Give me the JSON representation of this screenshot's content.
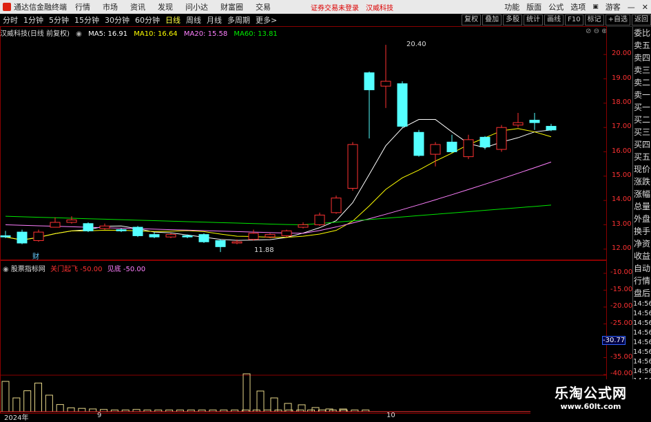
{
  "titlebar": {
    "app_name": "通达信金融终端",
    "menus": [
      "行情",
      "市场",
      "资讯",
      "发现",
      "问小达",
      "财富圈",
      "交易"
    ],
    "notice": "证券交易未登录",
    "stock_name_top": "汉威科技",
    "right_items": [
      "功能",
      "版面",
      "公式",
      "选项"
    ],
    "user": "游客"
  },
  "toolbar": {
    "periods": [
      "分时",
      "1分钟",
      "5分钟",
      "15分钟",
      "30分钟",
      "60分钟",
      "日线",
      "周线",
      "月线",
      "多周期",
      "更多>"
    ],
    "active_period": "日线",
    "right_buttons": [
      "复权",
      "叠加",
      "多股",
      "统计",
      "画线",
      "F10",
      "标记",
      "+自选",
      "返回"
    ]
  },
  "infobar": {
    "title": "汉威科技(日线 前复权)",
    "ma5": "MA5: 16.91",
    "ma10": "MA10: 16.64",
    "ma20": "MA20: 15.58",
    "ma60": "MA60: 13.81"
  },
  "price_axis": [
    "20.00",
    "19.00",
    "18.00",
    "17.00",
    "16.00",
    "15.00",
    "14.00",
    "13.00",
    "12.00"
  ],
  "annotations": {
    "high": "20.40",
    "low": "11.88",
    "cai": "财"
  },
  "indicator": {
    "name": "股票指标网",
    "l1": "关门起飞",
    "v1": "-50.00",
    "l2": "见底",
    "v2": "-50.00",
    "axis": [
      "-10.00",
      "-15.00",
      "-20.00",
      "-25.00",
      "-30.77",
      "-35.00",
      "-40.00"
    ],
    "current": "-30.77"
  },
  "date_axis": {
    "year": "2024年",
    "m1": "9",
    "m2": "10"
  },
  "right_panel": [
    "委比",
    "卖五",
    "卖四",
    "卖三",
    "卖二",
    "卖一",
    "买一",
    "买二",
    "买三",
    "买四",
    "买五",
    "现价",
    "涨跌",
    "涨幅",
    "总量",
    "外盘",
    "换手",
    "净资",
    "收益",
    "自动",
    "行情",
    "盘后",
    "14:56",
    "14:56",
    "14:56",
    "14:56",
    "14:56",
    "14:56",
    "14:56",
    "14:56",
    "14:56"
  ],
  "watermark": {
    "line1": "乐淘公式网",
    "line2": "www.60lt.com"
  },
  "colors": {
    "up": "#ff3232",
    "down": "#54ffff",
    "ma5": "#ffffff",
    "ma10": "#ffff00",
    "ma20": "#ff80ff",
    "ma60": "#00e600"
  },
  "candles": [
    {
      "o": 12.55,
      "c": 12.5,
      "h": 12.75,
      "l": 12.45
    },
    {
      "o": 12.7,
      "c": 12.25,
      "h": 12.8,
      "l": 12.2
    },
    {
      "o": 12.35,
      "c": 12.7,
      "h": 12.8,
      "l": 12.3
    },
    {
      "o": 12.9,
      "c": 13.1,
      "h": 13.3,
      "l": 12.9
    },
    {
      "o": 13.1,
      "c": 13.2,
      "h": 13.35,
      "l": 13.05
    },
    {
      "o": 13.05,
      "c": 12.75,
      "h": 13.1,
      "l": 12.7
    },
    {
      "o": 12.85,
      "c": 12.95,
      "h": 13.05,
      "l": 12.8
    },
    {
      "o": 12.8,
      "c": 12.75,
      "h": 12.85,
      "l": 12.7
    },
    {
      "o": 12.9,
      "c": 12.55,
      "h": 12.95,
      "l": 12.5
    },
    {
      "o": 12.6,
      "c": 12.5,
      "h": 12.7,
      "l": 12.45
    },
    {
      "o": 12.5,
      "c": 12.6,
      "h": 12.65,
      "l": 12.45
    },
    {
      "o": 12.55,
      "c": 12.5,
      "h": 12.6,
      "l": 12.45
    },
    {
      "o": 12.6,
      "c": 12.3,
      "h": 12.65,
      "l": 12.25
    },
    {
      "o": 12.35,
      "c": 12.1,
      "h": 12.4,
      "l": 11.88
    },
    {
      "o": 12.25,
      "c": 12.3,
      "h": 12.4,
      "l": 12.2
    },
    {
      "o": 12.4,
      "c": 12.65,
      "h": 12.8,
      "l": 12.35
    },
    {
      "o": 12.5,
      "c": 12.6,
      "h": 12.65,
      "l": 12.45
    },
    {
      "o": 12.55,
      "c": 12.75,
      "h": 12.8,
      "l": 12.5
    },
    {
      "o": 12.9,
      "c": 13.0,
      "h": 13.1,
      "l": 12.85
    },
    {
      "o": 13.0,
      "c": 13.4,
      "h": 13.5,
      "l": 12.95
    },
    {
      "o": 13.5,
      "c": 14.1,
      "h": 14.2,
      "l": 13.45
    },
    {
      "o": 14.5,
      "c": 16.3,
      "h": 16.4,
      "l": 14.4
    },
    {
      "o": 19.25,
      "c": 18.55,
      "h": 19.3,
      "l": 16.55
    },
    {
      "o": 18.7,
      "c": 18.9,
      "h": 20.4,
      "l": 17.8
    },
    {
      "o": 18.8,
      "c": 17.05,
      "h": 18.9,
      "l": 17.0
    },
    {
      "o": 16.8,
      "c": 15.85,
      "h": 16.9,
      "l": 15.8
    },
    {
      "o": 15.9,
      "c": 16.3,
      "h": 16.4,
      "l": 15.4
    },
    {
      "o": 16.4,
      "c": 16.0,
      "h": 16.7,
      "l": 15.95
    },
    {
      "o": 15.8,
      "c": 16.5,
      "h": 16.7,
      "l": 15.7
    },
    {
      "o": 16.6,
      "c": 16.2,
      "h": 16.65,
      "l": 16.1
    },
    {
      "o": 16.1,
      "c": 17.0,
      "h": 17.1,
      "l": 16.0
    },
    {
      "o": 17.1,
      "c": 17.2,
      "h": 17.6,
      "l": 17.0
    },
    {
      "o": 17.3,
      "c": 17.2,
      "h": 17.6,
      "l": 16.9
    },
    {
      "o": 17.05,
      "c": 16.9,
      "h": 17.15,
      "l": 16.85
    }
  ],
  "volumes": [
    3,
    2,
    3,
    5,
    6,
    3,
    2,
    1,
    1,
    0.8,
    0.5,
    0.5,
    0.4,
    0.3,
    0.4,
    0.4,
    0.3,
    0.3,
    0.3,
    0.3,
    0.3,
    0.4,
    0.5,
    0.6,
    0.4,
    0.3,
    0.3,
    0.3,
    0.3,
    0.2,
    0.3,
    0.3,
    0.3,
    0.2
  ],
  "volumes2": [
    5.5,
    2.5,
    3.8,
    5.2,
    3.0,
    1.3,
    0.7,
    0.6,
    0.5,
    0.4,
    0.3,
    0.3,
    0.4,
    0.3,
    0.3,
    0.3,
    0.3,
    0.3,
    0.3,
    0.3,
    0.3,
    0.3,
    0.3,
    0.3,
    0.3,
    0.3,
    0.3,
    0.3,
    0.3,
    0.3,
    0.3,
    0.3,
    0.3,
    0.3
  ]
}
